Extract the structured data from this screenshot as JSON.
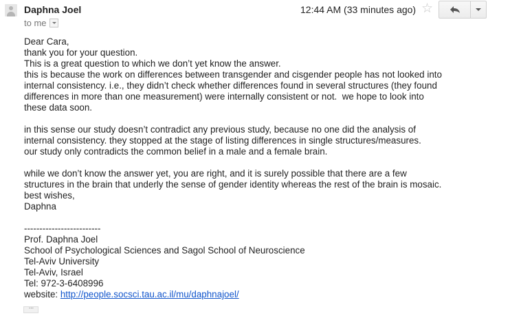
{
  "header": {
    "sender_name": "Daphna Joel",
    "recipient": "to me",
    "date": "12:44 AM (33 minutes ago)"
  },
  "icons": {
    "avatar": "person-silhouette-icon",
    "star": "star-outline-icon",
    "reply": "reply-arrow-icon",
    "more": "chevron-down-icon",
    "details": "chevron-down-icon",
    "trimmed": "ellipsis-icon"
  },
  "colors": {
    "link": "#1155cc",
    "text": "#222222",
    "muted": "#777777"
  },
  "body": {
    "greeting": "Dear Cara,",
    "lines": [
      "thank you for your question.",
      "This is a great question to which we don’t yet know the answer.",
      "this is because the work on differences between transgender and cisgender people has not looked into",
      "internal consistency. i.e., they didn’t check whether differences found in several structures (they found",
      "differences in more than one measurement) were internally consistent or not.  we hope to look into",
      "these data soon.",
      "",
      "in this sense our study doesn’t contradict any previous study, because no one did the analysis of",
      "internal consistency. they stopped at the stage of listing differences in single structures/measures.",
      "our study only contradicts the common belief in a male and a female brain.",
      "",
      "while we don’t know the answer yet, you are right, and it is surely possible that there are a few",
      "structures in the brain that underly the sense of gender identity whereas the rest of the brain is mosaic.",
      "best wishes,",
      "Daphna"
    ]
  },
  "signature": {
    "divider": "-------------------------",
    "name": "Prof. Daphna Joel",
    "affiliation": "School of Psychological Sciences and Sagol School of Neuroscience",
    "university": "Tel-Aviv University",
    "location": "Tel-Aviv, Israel",
    "tel": "Tel: 972-3-6408996",
    "website_label": "website: ",
    "website_url": "http://people.socsci.tau.ac.il/mu/daphnajoel/"
  }
}
